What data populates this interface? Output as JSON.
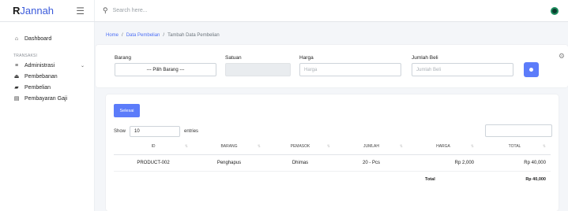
{
  "brand": {
    "logo_r": "R",
    "logo_rest": "Jannah"
  },
  "search": {
    "placeholder": "Search here..."
  },
  "sidebar": {
    "dashboard": "Dashboard",
    "section": "TRANSAKSI",
    "items": [
      {
        "label": "Administrasi"
      },
      {
        "label": "Pembebanan"
      },
      {
        "label": "Pembelian"
      },
      {
        "label": "Pembayaran Gaji"
      }
    ]
  },
  "breadcrumb": {
    "home": "Home",
    "sep": "/",
    "data": "Data Pembelian",
    "current": "Tambah Data Pembelian"
  },
  "form": {
    "barang_label": "Barang",
    "barang_value": "--- Pilih Barang ---",
    "satuan_label": "Satuan",
    "harga_label": "Harga",
    "harga_placeholder": "Harga",
    "jumlah_label": "Jumlah Beli",
    "jumlah_placeholder": "Jumlah Beli"
  },
  "table_ctrl": {
    "selesai": "Selesai",
    "show": "Show",
    "entries_value": "10",
    "entries": "entries"
  },
  "table": {
    "headers": [
      "ID",
      "BARANG",
      "PEMASOK",
      "JUMLAH",
      "HARGA",
      "TOTAL"
    ],
    "rows": [
      {
        "id": "PRODUCT-002",
        "barang": "Penghapus",
        "pemasok": "Dhimas",
        "jumlah": "20 - Pcs",
        "harga": "Rp 2,000",
        "total": "Rp 40,000"
      }
    ],
    "total_label": "Total",
    "total_value": "Rp 40,000"
  }
}
